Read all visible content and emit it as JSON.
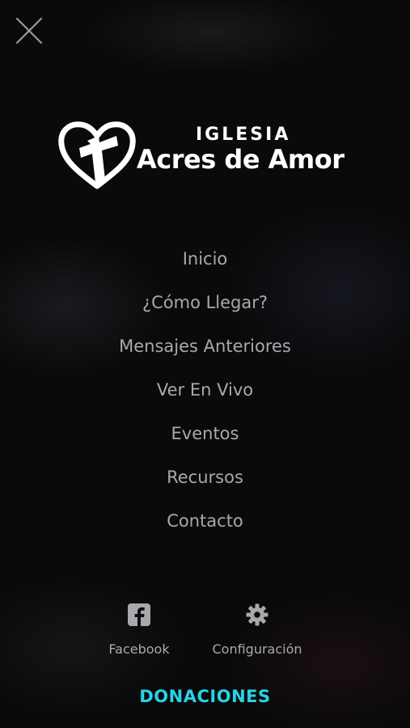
{
  "header": {
    "close_icon": "close-icon"
  },
  "logo": {
    "line1": "IGLESIA",
    "line2": "Acres de Amor",
    "icon": "heart-cross-icon"
  },
  "menu": {
    "items": [
      {
        "label": "Inicio"
      },
      {
        "label": "¿Cómo Llegar?"
      },
      {
        "label": "Mensajes Anteriores"
      },
      {
        "label": "Ver En Vivo"
      },
      {
        "label": "Eventos"
      },
      {
        "label": "Recursos"
      },
      {
        "label": "Contacto"
      }
    ]
  },
  "actions": {
    "facebook": {
      "label": "Facebook",
      "icon": "facebook-icon"
    },
    "config": {
      "label": "Configuración",
      "icon": "gear-icon"
    }
  },
  "donate": {
    "label": "DONACIONES"
  },
  "colors": {
    "background": "#0a0a0b",
    "menu_text": "#a9a9ad",
    "accent": "#27d3e8",
    "logo": "#ffffff"
  }
}
